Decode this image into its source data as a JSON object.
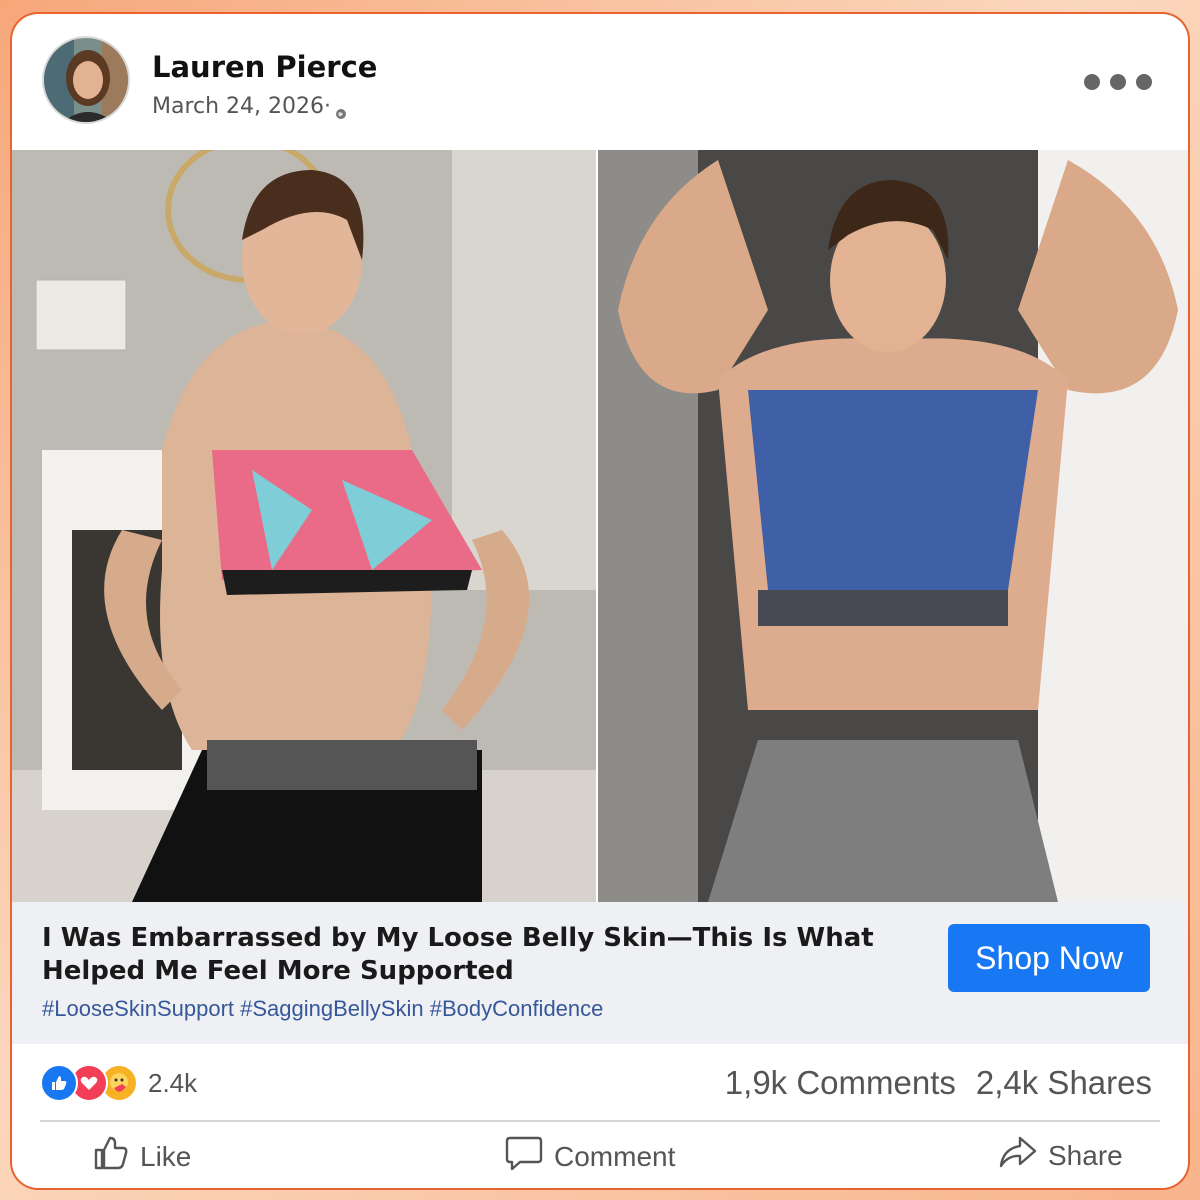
{
  "post": {
    "author": "Lauren Pierce",
    "date": "March 24, 2026·",
    "more_icon": "more-horizontal-icon"
  },
  "caption": {
    "headline": "I Was Embarrassed by My Loose Belly Skin—This Is What Helped Me Feel More Supported",
    "hashtags": "#LooseSkinSupport #SaggingBellySkin #BodyConfidence",
    "cta": "Shop Now"
  },
  "stats": {
    "reactions": "2.4k",
    "comments": "1,9k Comments",
    "shares": "2,4k Shares"
  },
  "actions": {
    "like": "Like",
    "comment": "Comment",
    "share": "Share"
  },
  "colors": {
    "brand": "#1877f2",
    "border": "#e8632d",
    "caption_bg": "#eef0f4",
    "hashtag": "#365899"
  }
}
